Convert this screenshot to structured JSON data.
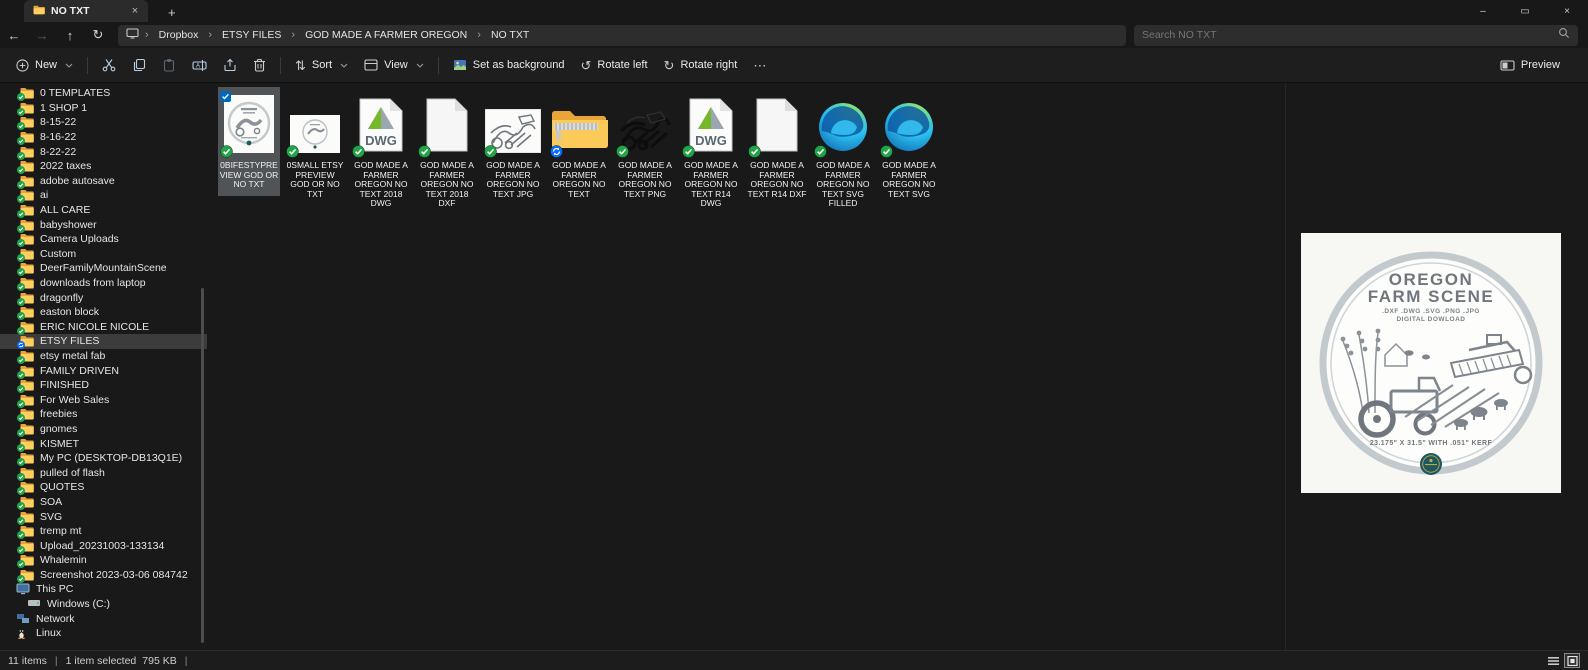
{
  "window": {
    "tab_title": "NO TXT"
  },
  "icons": {
    "back": "←",
    "forward": "→",
    "up": "↑",
    "refresh": "↻",
    "rotate_left": "↺",
    "rotate_right": "↻",
    "sort": "⇅",
    "more": "⋯",
    "new_plus": "+",
    "tab_new": "+",
    "minimize": "–",
    "maximize": "▭",
    "close": "×",
    "tab_close": "×",
    "breadcrumb_sep": "›"
  },
  "breadcrumb": [
    "Dropbox",
    "ETSY FILES",
    "GOD MADE A FARMER OREGON",
    "NO TXT"
  ],
  "search": {
    "placeholder": "Search NO TXT"
  },
  "toolbar": {
    "new": "New",
    "sort": "Sort",
    "view": "View",
    "set_as_background": "Set as background",
    "rotate_left": "Rotate left",
    "rotate_right": "Rotate right",
    "preview": "Preview"
  },
  "sidebar": {
    "items": [
      {
        "label": "0 TEMPLATES",
        "icon": "folder",
        "badge": "check"
      },
      {
        "label": "1 SHOP 1",
        "icon": "folder",
        "badge": "check"
      },
      {
        "label": "8-15-22",
        "icon": "folder",
        "badge": "check"
      },
      {
        "label": "8-16-22",
        "icon": "folder",
        "badge": "check"
      },
      {
        "label": "8-22-22",
        "icon": "folder",
        "badge": "check"
      },
      {
        "label": "2022 taxes",
        "icon": "folder",
        "badge": "check"
      },
      {
        "label": "adobe autosave",
        "icon": "folder",
        "badge": "check"
      },
      {
        "label": "ai",
        "icon": "folder",
        "badge": "check"
      },
      {
        "label": "ALL CARE",
        "icon": "folder",
        "badge": "check"
      },
      {
        "label": "babyshower",
        "icon": "folder",
        "badge": "check"
      },
      {
        "label": "Camera Uploads",
        "icon": "folder",
        "badge": "check"
      },
      {
        "label": "Custom",
        "icon": "folder",
        "badge": "check"
      },
      {
        "label": "DeerFamilyMountainScene",
        "icon": "folder",
        "badge": "check"
      },
      {
        "label": "downloads from laptop",
        "icon": "folder",
        "badge": "check"
      },
      {
        "label": "dragonfly",
        "icon": "folder",
        "badge": "check"
      },
      {
        "label": "easton block",
        "icon": "folder",
        "badge": "check"
      },
      {
        "label": "ERIC NICOLE NICOLE",
        "icon": "folder",
        "badge": "check"
      },
      {
        "label": "ETSY FILES",
        "icon": "folder",
        "badge": "sync",
        "selected": true
      },
      {
        "label": "etsy metal fab",
        "icon": "folder",
        "badge": "check"
      },
      {
        "label": "FAMILY DRIVEN",
        "icon": "folder",
        "badge": "check"
      },
      {
        "label": "FINISHED",
        "icon": "folder",
        "badge": "check"
      },
      {
        "label": "For Web Sales",
        "icon": "folder",
        "badge": "check"
      },
      {
        "label": "freebies",
        "icon": "folder",
        "badge": "check"
      },
      {
        "label": "gnomes",
        "icon": "folder",
        "badge": "check"
      },
      {
        "label": "KISMET",
        "icon": "folder",
        "badge": "check"
      },
      {
        "label": "My PC (DESKTOP-DB13Q1E)",
        "icon": "folder",
        "badge": "check"
      },
      {
        "label": "pulled of flash",
        "icon": "folder",
        "badge": "check"
      },
      {
        "label": "QUOTES",
        "icon": "folder",
        "badge": "check"
      },
      {
        "label": "SOA",
        "icon": "folder",
        "badge": "check"
      },
      {
        "label": "SVG",
        "icon": "folder",
        "badge": "check"
      },
      {
        "label": "tremp mt",
        "icon": "folder",
        "badge": "check"
      },
      {
        "label": "Upload_20231003-133134",
        "icon": "folder",
        "badge": "check"
      },
      {
        "label": "Whalemin",
        "icon": "folder",
        "badge": "check"
      },
      {
        "label": "Screenshot 2023-03-06 084742",
        "icon": "folder",
        "badge": "check"
      },
      {
        "label": "This PC",
        "icon": "pc"
      },
      {
        "label": "Windows (C:)",
        "icon": "drive"
      },
      {
        "label": "Network",
        "icon": "network"
      },
      {
        "label": "Linux",
        "icon": "linux"
      }
    ]
  },
  "files": [
    {
      "name": "0BIFESTYPREVIEW GOD OR NO TXT",
      "icon": "preview-card",
      "badge": "check",
      "selected": true
    },
    {
      "name": "0SMALL ETSY PREVIEW GOD OR NO TXT",
      "icon": "preview-card-small",
      "badge": "check"
    },
    {
      "name": "GOD MADE A FARMER OREGON NO TEXT 2018 DWG",
      "icon": "dwg",
      "badge": "check"
    },
    {
      "name": "GOD MADE A FARMER OREGON NO TEXT 2018 DXF",
      "icon": "dxf",
      "badge": "check"
    },
    {
      "name": "GOD MADE A FARMER OREGON NO TEXT JPG",
      "icon": "jpg",
      "badge": "check"
    },
    {
      "name": "GOD MADE A FARMER OREGON NO TEXT",
      "icon": "zip",
      "badge": "sync"
    },
    {
      "name": "GOD MADE A FARMER OREGON NO TEXT PNG",
      "icon": "png",
      "badge": "check"
    },
    {
      "name": "GOD MADE A FARMER OREGON NO TEXT R14 DWG",
      "icon": "dwg",
      "badge": "check"
    },
    {
      "name": "GOD MADE A FARMER OREGON NO TEXT R14 DXF",
      "icon": "dxf",
      "badge": "check"
    },
    {
      "name": "GOD MADE A FARMER OREGON NO TEXT SVG FILLED",
      "icon": "edge",
      "badge": "check"
    },
    {
      "name": "GOD MADE A FARMER OREGON NO TEXT SVG",
      "icon": "edge",
      "badge": "check"
    }
  ],
  "preview": {
    "title_line1": "OREGON",
    "title_line2": "FARM SCENE",
    "formats": ".DXF .DWG .SVG .PNG .JPG",
    "subtitle": "DIGITAL DOWLOAD",
    "dimensions": "23.175\" X 31.5\" WITH .051\" KERF"
  },
  "status_bar": {
    "items": "11 items",
    "selected": "1 item selected",
    "size": "795 KB",
    "sep": "|"
  },
  "colors": {
    "accent_blue": "#4cc2ff",
    "folder_yellow": "#fcc94b",
    "sync_green": "#21a348",
    "sync_blue": "#0a6cff",
    "selection_bg": "#515457",
    "edge_blue": "#0c59a4",
    "edge_green": "#7ce577"
  }
}
